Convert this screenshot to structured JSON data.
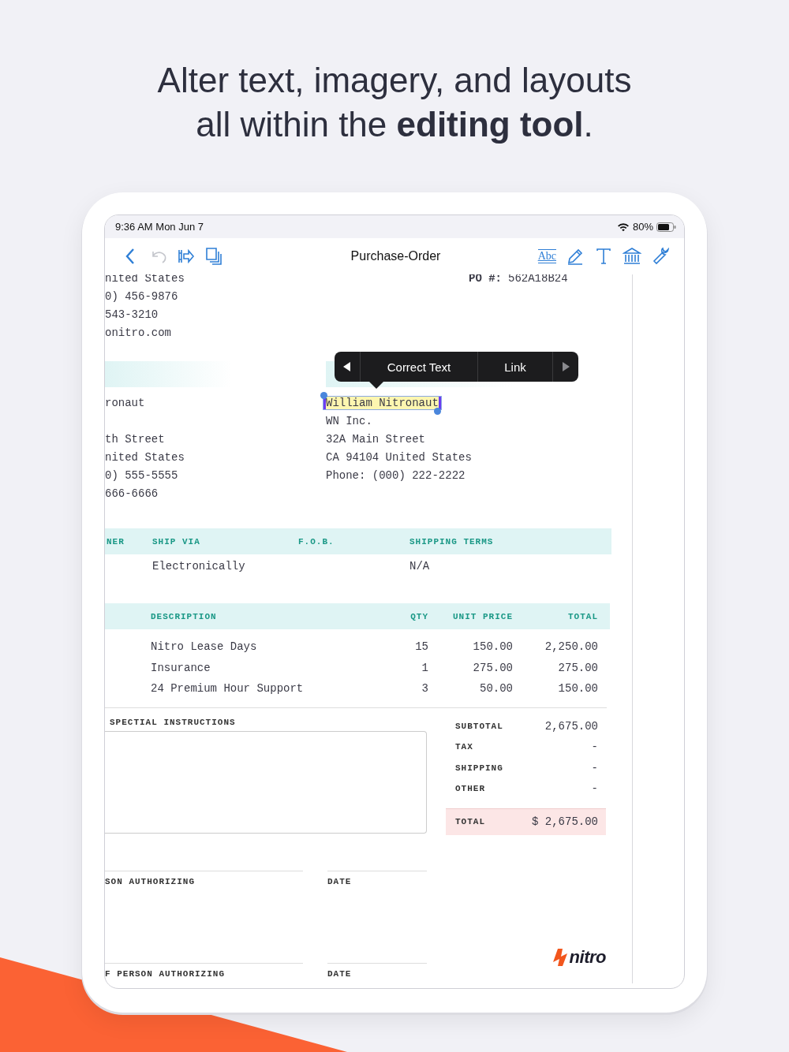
{
  "headline": {
    "lines": [
      "Alter text, imagery, and layouts",
      "all within the **editing tool**."
    ]
  },
  "status_bar": {
    "time": "9:36 AM Mon Jun 7",
    "battery": "80%"
  },
  "toolbar": {
    "title": "Purchase-Order",
    "left_tools": [
      {
        "kind": "back",
        "disabled": false
      },
      {
        "kind": "undo",
        "disabled": true
      },
      {
        "kind": "reflow",
        "disabled": false
      },
      {
        "kind": "pages",
        "disabled": false
      }
    ],
    "right_tools": [
      {
        "kind": "spellcheck",
        "label": "Abc"
      },
      {
        "kind": "pen"
      },
      {
        "kind": "text"
      },
      {
        "kind": "bank"
      },
      {
        "kind": "wrench"
      }
    ]
  },
  "document": {
    "sender_lines": [
      "nited States",
      "0) 456-9876",
      "543-3210",
      "onitro.com"
    ],
    "po": {
      "label": "PO #:",
      "value": "562A18B24"
    },
    "popup": {
      "items": [
        "Correct Text",
        "Link"
      ],
      "prev_disabled": false,
      "next_disabled": true
    },
    "bill_to": {
      "name": "ronaut",
      "lines": [
        "th Street",
        "nited States",
        "0) 555-5555",
        "666-6666"
      ]
    },
    "ship_to": {
      "name": "William Nitronaut",
      "selected": true,
      "lines": [
        "WN Inc.",
        "32A Main Street",
        "CA 94104 United States",
        "Phone: (000) 222-2222"
      ]
    },
    "shipping_table": {
      "columns": [
        "NER",
        "SHIP VIA",
        "F.O.B.",
        "SHIPPING TERMS"
      ],
      "row": {
        "ship_via": "Electronically",
        "shipping_terms": "N/A"
      }
    },
    "items_table": {
      "columns": [
        "DESCRIPTION",
        "QTY",
        "UNIT PRICE",
        "TOTAL"
      ],
      "rows": [
        {
          "description": "Nitro Lease Days",
          "qty": "15",
          "unit_price": "150.00",
          "total": "2,250.00"
        },
        {
          "description": "Insurance",
          "qty": "1",
          "unit_price": "275.00",
          "total": "275.00"
        },
        {
          "description": "24 Premium Hour Support",
          "qty": "3",
          "unit_price": "50.00",
          "total": "150.00"
        }
      ]
    },
    "special_instructions": {
      "label": "SPECTIAL INSTRUCTIONS"
    },
    "totals": [
      {
        "label": "SUBTOTAL",
        "value": "2,675.00"
      },
      {
        "label": "TAX",
        "value": "-"
      },
      {
        "label": "SHIPPING",
        "value": "-"
      },
      {
        "label": "OTHER",
        "value": "-"
      }
    ],
    "grand_total": {
      "label": "TOTAL",
      "value": "$ 2,675.00"
    },
    "signatures": [
      {
        "label": "SON AUTHORIZING",
        "date_label": "DATE"
      },
      {
        "label": "F PERSON AUTHORIZING",
        "date_label": "DATE"
      }
    ],
    "logo": "nitro"
  }
}
